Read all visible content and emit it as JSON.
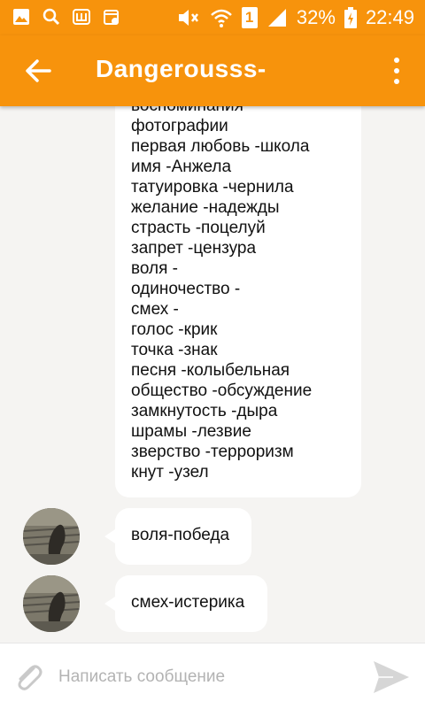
{
  "status_bar": {
    "battery_percent": "32%",
    "time": "22:49",
    "sim_label": "1",
    "icons": [
      "gallery-icon",
      "search-icon",
      "app-w-icon",
      "calendar-icon",
      "mute-icon",
      "wifi-icon",
      "sim-icon",
      "signal-icon",
      "battery-charging-icon"
    ]
  },
  "header": {
    "title": "Dangerousss-",
    "back_icon": "back-arrow-icon",
    "menu_icon": "more-vert-icon",
    "color": "#f7930c"
  },
  "messages": {
    "long_message_lines": [
      "воспоминания",
      "фотографии",
      "первая любовь -школа",
      "имя -Анжела",
      "татуировка -чернила",
      "желание -надежды",
      "страсть -поцелуй",
      "запрет -цензура",
      "воля -",
      "одиночество -",
      "смех -",
      "голос -крик",
      "точка -знак",
      "песня -колыбельная",
      "общество -обсуждение",
      "замкнутость -дыра",
      "шрамы -лезвие",
      "зверство -терроризм",
      "кнут -узел"
    ],
    "items": [
      {
        "text": "воля-победа"
      },
      {
        "text": "смех-истерика"
      }
    ]
  },
  "composer": {
    "placeholder": "Написать сообщение",
    "attach_icon": "paperclip-icon",
    "send_icon": "send-icon"
  }
}
